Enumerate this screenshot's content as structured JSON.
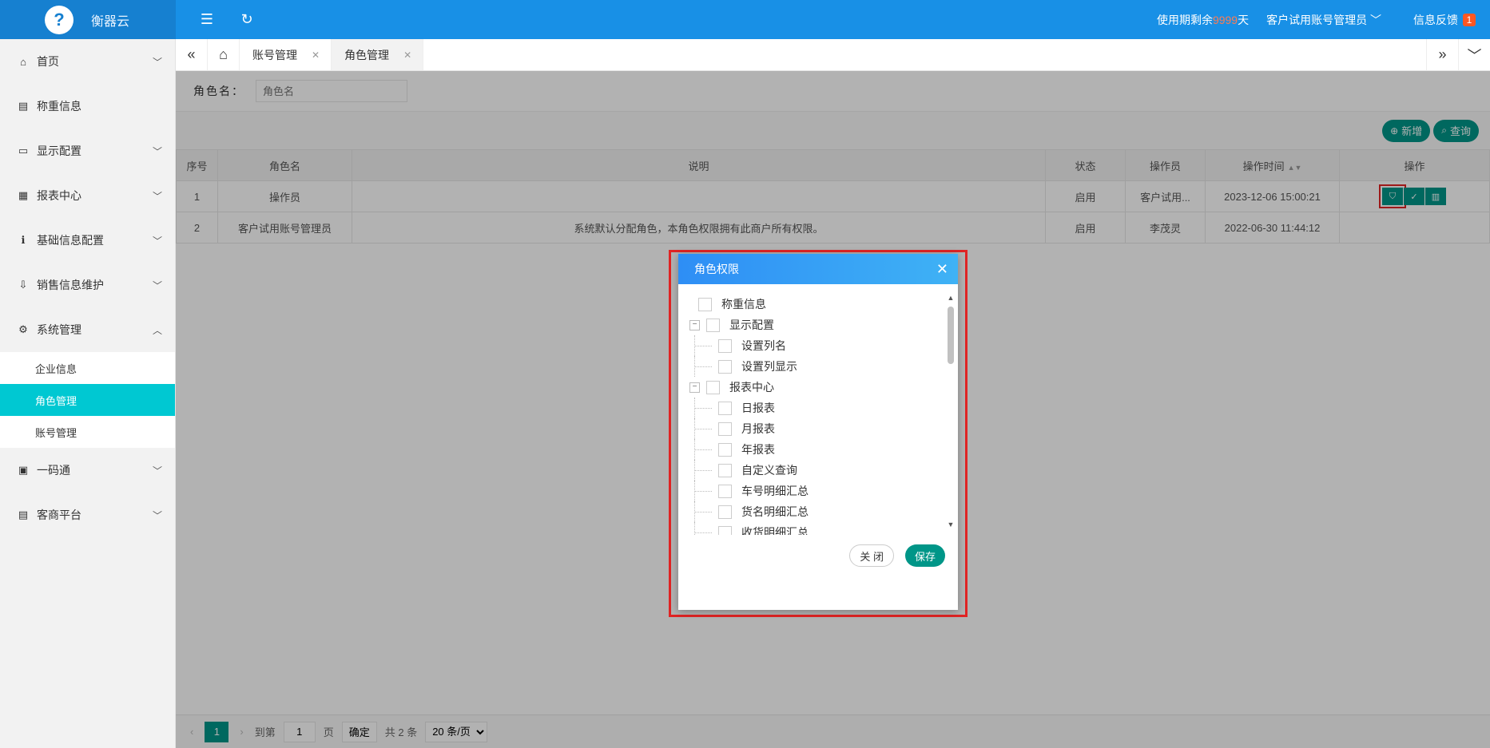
{
  "brand": {
    "logo_letter": "?",
    "name": "衡器云"
  },
  "topbar": {
    "trial_prefix": "使用期剩余",
    "trial_days": "9999",
    "trial_suffix": "天",
    "user": "客户试用账号管理员",
    "feedback": "信息反馈",
    "feedback_count": "1"
  },
  "sidebar": {
    "items": [
      {
        "label": "首页",
        "icon": "⌂",
        "arrow": "﹀"
      },
      {
        "label": "称重信息",
        "icon": "▤",
        "arrow": ""
      },
      {
        "label": "显示配置",
        "icon": "▭",
        "arrow": "﹀"
      },
      {
        "label": "报表中心",
        "icon": "▦",
        "arrow": "﹀"
      },
      {
        "label": "基础信息配置",
        "icon": "ℹ",
        "arrow": "﹀"
      },
      {
        "label": "销售信息维护",
        "icon": "⇩",
        "arrow": "﹀"
      },
      {
        "label": "系统管理",
        "icon": "⚙",
        "arrow": "︿"
      }
    ],
    "sub_items": [
      {
        "label": "企业信息"
      },
      {
        "label": "角色管理"
      },
      {
        "label": "账号管理"
      }
    ],
    "items_after": [
      {
        "label": "一码通",
        "icon": "▣",
        "arrow": "﹀"
      },
      {
        "label": "客商平台",
        "icon": "▤",
        "arrow": "﹀"
      }
    ]
  },
  "tabs": [
    {
      "label": "账号管理"
    },
    {
      "label": "角色管理"
    }
  ],
  "search": {
    "label": "角色名：",
    "placeholder": "角色名"
  },
  "toolbar": {
    "add": "新增",
    "query": "查询"
  },
  "table": {
    "headers": [
      "序号",
      "角色名",
      "说明",
      "状态",
      "操作员",
      "操作时间",
      "操作"
    ],
    "rows": [
      [
        "1",
        "操作员",
        "",
        "启用",
        "客户试用...",
        "2023-12-06 15:00:21"
      ],
      [
        "2",
        "客户试用账号管理员",
        "系统默认分配角色，本角色权限拥有此商户所有权限。",
        "启用",
        "李茂灵",
        "2022-06-30 11:44:12"
      ]
    ]
  },
  "pager": {
    "current": "1",
    "goto": "到第",
    "page_input": "1",
    "page_unit": "页",
    "confirm": "确定",
    "total": "共 2 条",
    "page_size": "20 条/页"
  },
  "modal": {
    "title": "角色权限",
    "tree": [
      {
        "label": "称重信息",
        "level": 1,
        "toggle": ""
      },
      {
        "label": "显示配置",
        "level": 1,
        "toggle": "−"
      },
      {
        "label": "设置列名",
        "level": 2
      },
      {
        "label": "设置列显示",
        "level": 2
      },
      {
        "label": "报表中心",
        "level": 1,
        "toggle": "−"
      },
      {
        "label": "日报表",
        "level": 2
      },
      {
        "label": "月报表",
        "level": 2
      },
      {
        "label": "年报表",
        "level": 2
      },
      {
        "label": "自定义查询",
        "level": 2
      },
      {
        "label": "车号明细汇总",
        "level": 2
      },
      {
        "label": "货名明细汇总",
        "level": 2
      },
      {
        "label": "收货明细汇总",
        "level": 2
      }
    ],
    "close_button": "关 闭",
    "save_button": "保存"
  }
}
